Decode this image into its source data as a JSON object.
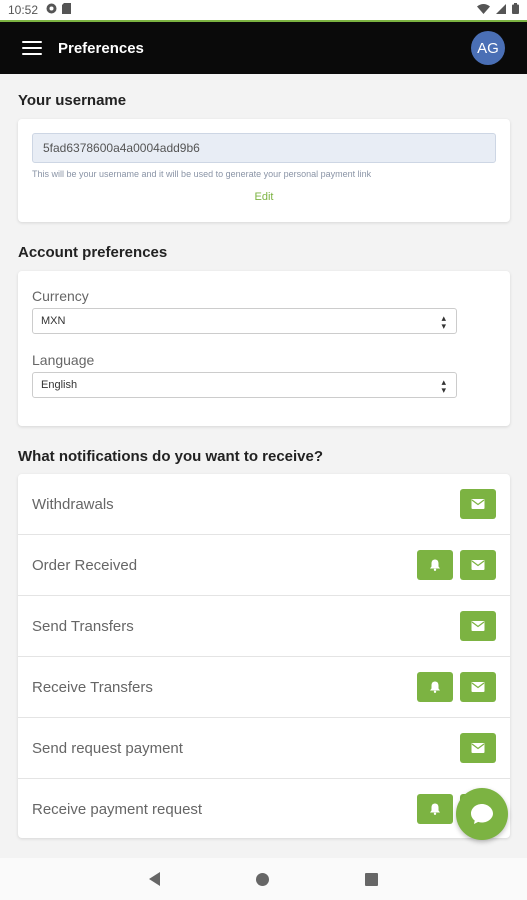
{
  "status": {
    "time": "10:52"
  },
  "appbar": {
    "title": "Preferences",
    "avatar": "AG"
  },
  "username": {
    "section_title": "Your username",
    "value": "5fad6378600a4a0004add9b6",
    "hint": "This will be your username and it will be used to generate your personal payment link",
    "edit": "Edit"
  },
  "account": {
    "section_title": "Account preferences",
    "currency_label": "Currency",
    "currency_value": "MXN",
    "language_label": "Language",
    "language_value": "English"
  },
  "notifications": {
    "section_title": "What notifications do you want to receive?",
    "rows": [
      {
        "label": "Withdrawals",
        "bell": false,
        "email": true
      },
      {
        "label": "Order Received",
        "bell": true,
        "email": true
      },
      {
        "label": "Send Transfers",
        "bell": false,
        "email": true
      },
      {
        "label": "Receive Transfers",
        "bell": true,
        "email": true
      },
      {
        "label": "Send request payment",
        "bell": false,
        "email": true
      },
      {
        "label": "Receive payment request",
        "bell": true,
        "email": true
      }
    ]
  },
  "icons": {
    "bell": "bell-icon",
    "email": "envelope-icon",
    "chat": "chat-bubble-icon",
    "menu": "hamburger-menu-icon"
  },
  "colors": {
    "accent": "#7cb342",
    "appbar": "#0a0a0a",
    "avatar": "#4a6fb5"
  }
}
